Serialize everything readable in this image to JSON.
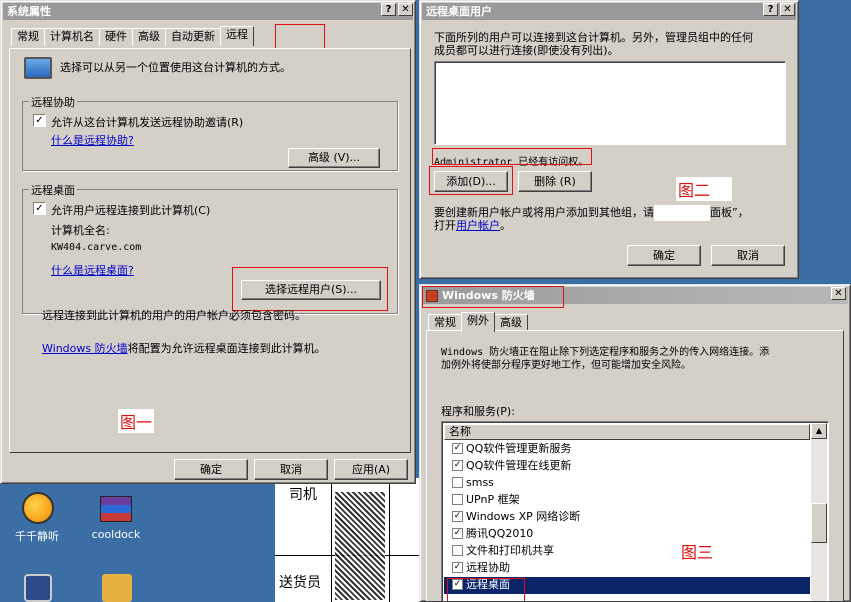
{
  "sysprops": {
    "title": "系统属性",
    "tabs": [
      "常规",
      "计算机名",
      "硬件",
      "高级",
      "自动更新",
      "远程"
    ],
    "intro": "选择可以从另一个位置使用这台计算机的方式。",
    "assist_group": "远程协助",
    "assist_check": "允许从这台计算机发送远程协助邀请",
    "assist_check_key": "(R)",
    "assist_link": "什么是远程协助?",
    "advanced_btn": "高级",
    "advanced_btn_key": "(V)...",
    "desktop_group": "远程桌面",
    "desktop_check": "允许用户远程连接到此计算机",
    "desktop_check_key": "(C)",
    "fullname_label": "计算机全名:",
    "fullname_value": "KW404.carve.com",
    "desktop_link": "什么是远程桌面?",
    "select_users_btn": "选择远程用户",
    "select_users_key": "(S)...",
    "password_note": "远程连接到此计算机的用户的用户帐户必须包含密码。",
    "firewall_link": "Windows 防火墙",
    "firewall_note": "将配置为允许远程桌面连接到此计算机。",
    "annotation": "图一",
    "ok": "确定",
    "cancel": "取消",
    "apply": "应用",
    "apply_key": "(A)"
  },
  "remote_users": {
    "title": "远程桌面用户",
    "desc1": "下面所列的用户可以连接到这台计算机。另外，管理员组中的任何",
    "desc2": "成员都可以进行连接(即使没有列出)。",
    "admin_note": "Administrator 已经有访问权。",
    "add_btn": "添加",
    "add_key": "(D)...",
    "remove_btn": "删除",
    "remove_key": "(R)",
    "annotation": "图二",
    "hint1a": "要创建新用户帐户或将用户添加到其他组，请",
    "hint1b": "面板”，",
    "hint2a": "打开",
    "hint2_link": "用户帐户",
    "hint2b": "。",
    "ok": "确定",
    "cancel": "取消"
  },
  "firewall": {
    "title": "Windows 防火墙",
    "tabs": [
      "常规",
      "例外",
      "高级"
    ],
    "desc1": "Windows 防火墙正在阻止除下列选定程序和服务之外的传入网络连接。添",
    "desc2": "加例外将使部分程序更好地工作，但可能增加安全风险。",
    "list_label": "程序和服务",
    "list_key": "(P):",
    "column": "名称",
    "items": [
      {
        "label": "QQ软件管理更新服务",
        "checked": true
      },
      {
        "label": "QQ软件管理在线更新",
        "checked": true
      },
      {
        "label": "smss",
        "checked": false
      },
      {
        "label": "UPnP 框架",
        "checked": false
      },
      {
        "label": "Windows XP 网络诊断",
        "checked": true
      },
      {
        "label": "腾讯QQ2010",
        "checked": true
      },
      {
        "label": "文件和打印机共享",
        "checked": false
      },
      {
        "label": "远程协助",
        "checked": true
      },
      {
        "label": "远程桌面",
        "checked": true
      }
    ],
    "annotation": "图三"
  },
  "desktop": {
    "icons": [
      {
        "label": "千千静听",
        "name": "ttplayer-icon"
      },
      {
        "label": "cooldock",
        "name": "winrar-icon"
      }
    ],
    "doc_row1": "司机",
    "doc_row2": "送货员"
  },
  "colors": {
    "accent_red": "#e01010",
    "link": "#0000cc",
    "desktop": "#3a6ea5"
  }
}
